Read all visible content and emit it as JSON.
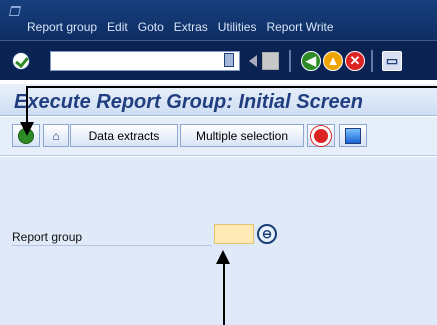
{
  "menu": {
    "items": [
      "Report group",
      "Edit",
      "Goto",
      "Extras",
      "Utilities",
      "Report Write"
    ]
  },
  "standard_toolbar": {
    "command_field_value": "",
    "icons": [
      "check-icon",
      "collapse-icon",
      "back-triangle-icon",
      "save-icon",
      "back-icon",
      "exit-icon",
      "cancel-icon",
      "print-icon"
    ]
  },
  "screen_title": "Execute Report Group: Initial Screen",
  "application_toolbar": {
    "data_extracts_label": "Data extracts",
    "multiple_selection_label": "Multiple selection"
  },
  "form": {
    "report_group_label": "Report group",
    "report_group_value": "",
    "value_help_symbol": "⊖"
  },
  "colors": {
    "menu_bar": "#17407e",
    "title_text": "#213f80",
    "panel_background": "#dfe9f7",
    "input_background": "#ffe9b4"
  }
}
